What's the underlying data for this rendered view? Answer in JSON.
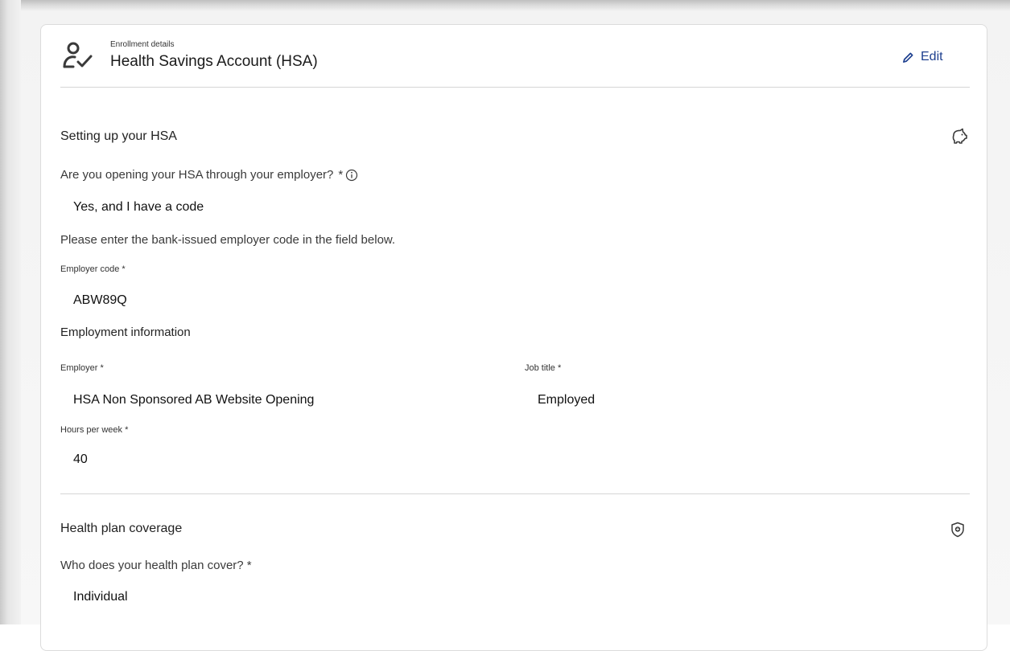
{
  "header": {
    "eyebrow": "Enrollment details",
    "title": "Health Savings Account (HSA)",
    "edit_label": "Edit",
    "icon": "user-check-icon"
  },
  "setup": {
    "title": "Setting up your HSA",
    "icon": "piggy-bank-icon",
    "question": "Are you opening your HSA through your employer?",
    "required_mark": "*",
    "answer": "Yes, and I have a code",
    "instruction": "Please enter the bank-issued employer code in the field below.",
    "employer_code_label": "Employer code *",
    "employer_code_value": "ABW89Q",
    "employment_heading": "Employment information",
    "employer_label": "Employer *",
    "employer_value": "HSA Non Sponsored AB Website Opening",
    "job_title_label": "Job title *",
    "job_title_value": "Employed",
    "hours_label": "Hours per week *",
    "hours_value": "40"
  },
  "coverage": {
    "title": "Health plan coverage",
    "icon": "shield-plus-icon",
    "question": "Who does your health plan cover? *",
    "answer": "Individual"
  },
  "colors": {
    "accent": "#1d3f8f",
    "divider": "#d6d6d6",
    "text": "#1f1f1f"
  }
}
